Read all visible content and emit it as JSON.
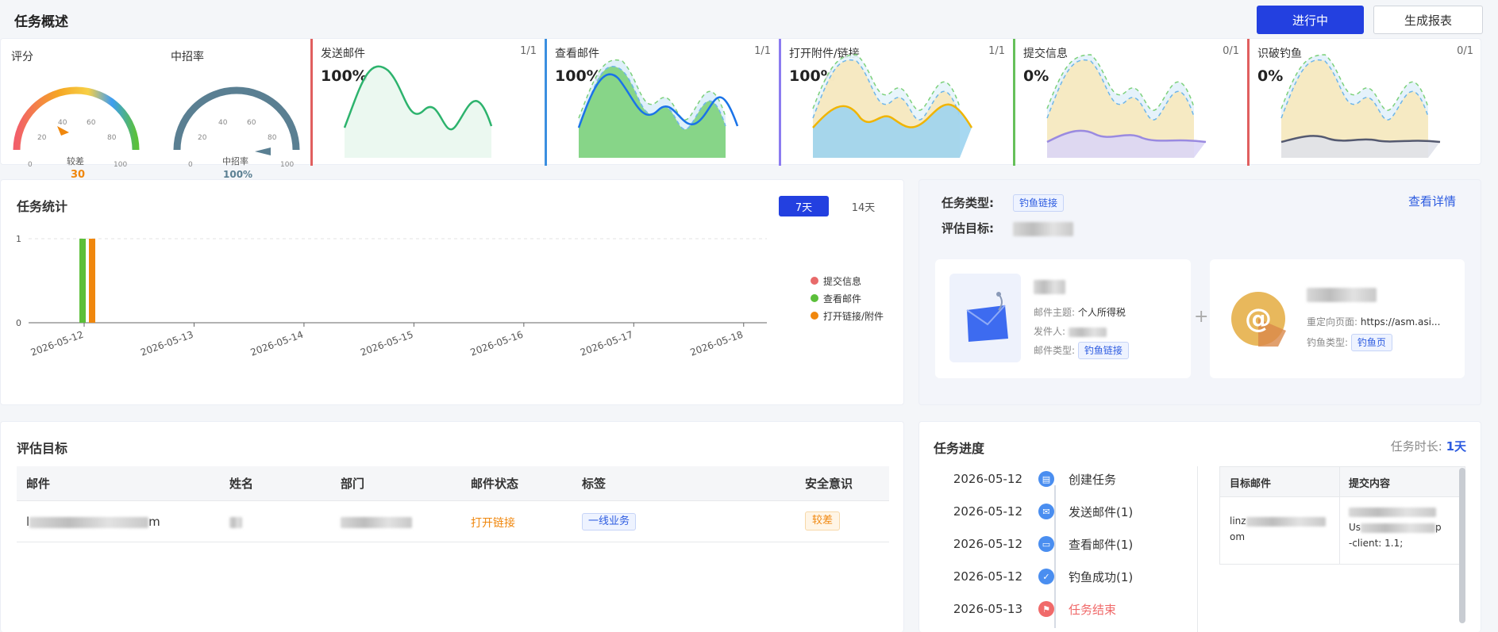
{
  "header": {
    "title": "任务概述",
    "status_button": "进行中",
    "report_button": "生成报表"
  },
  "gauges": {
    "score": {
      "label": "评分",
      "inner_label": "较差",
      "value": "30",
      "ticks": [
        "0",
        "20",
        "40",
        "60",
        "80",
        "100"
      ]
    },
    "rate": {
      "label": "中招率",
      "inner_label": "中招率",
      "value": "100%",
      "ticks": [
        "0",
        "20",
        "40",
        "60",
        "80",
        "100"
      ]
    }
  },
  "metrics": [
    {
      "title": "发送邮件",
      "fraction": "1/1",
      "value": "100%",
      "color": "#e05f5f",
      "line": "#2db36d"
    },
    {
      "title": "查看邮件",
      "fraction": "1/1",
      "value": "100%",
      "color": "#3b8fe0",
      "line": "#1a73e8"
    },
    {
      "title": "打开附件/链接",
      "fraction": "1/1",
      "value": "100%",
      "color": "#8c7bf0",
      "line": "#f0b400"
    },
    {
      "title": "提交信息",
      "fraction": "0/1",
      "value": "0%",
      "color": "#66c05a",
      "line": "#9a8ae0"
    },
    {
      "title": "识破钓鱼",
      "fraction": "0/1",
      "value": "0%",
      "color": "#e05f5f",
      "line": "#555a70"
    }
  ],
  "stats": {
    "title": "任务统计",
    "range_7": "7天",
    "range_14": "14天",
    "legend": [
      {
        "name": "提交信息",
        "color": "#e86a6a"
      },
      {
        "name": "查看邮件",
        "color": "#5bbf3a"
      },
      {
        "name": "打开链接/附件",
        "color": "#f0870d"
      }
    ]
  },
  "chart_data": {
    "type": "bar",
    "categories": [
      "2026-05-12",
      "2026-05-13",
      "2026-05-14",
      "2026-05-15",
      "2026-05-16",
      "2026-05-17",
      "2026-05-18"
    ],
    "series": [
      {
        "name": "提交信息",
        "values": [
          0,
          0,
          0,
          0,
          0,
          0,
          0
        ],
        "color": "#e86a6a"
      },
      {
        "name": "查看邮件",
        "values": [
          1,
          0,
          0,
          0,
          0,
          0,
          0
        ],
        "color": "#5bbf3a"
      },
      {
        "name": "打开链接/附件",
        "values": [
          1,
          0,
          0,
          0,
          0,
          0,
          0
        ],
        "color": "#f0870d"
      }
    ],
    "ylim": [
      0,
      1
    ],
    "yticks": [
      "0",
      "1"
    ],
    "grid": true,
    "legend": "right"
  },
  "taskinfo": {
    "type_label": "任务类型:",
    "type_value": "钓鱼链接",
    "target_label": "评估目标:",
    "detail_link": "查看详情",
    "mail_subject_label": "邮件主题:",
    "mail_subject": "个人所得税",
    "sender_label": "发件人:",
    "mail_type_label": "邮件类型:",
    "mail_type": "钓鱼链接",
    "plus": "+",
    "redirect_label": "重定向页面:",
    "redirect_value": "https://asm.asi...",
    "phish_type_label": "钓鱼类型:",
    "phish_type": "钓鱼页"
  },
  "targets": {
    "title": "评估目标",
    "columns": [
      "邮件",
      "姓名",
      "部门",
      "邮件状态",
      "标签",
      "安全意识"
    ],
    "row": {
      "email_end": "m",
      "email_start": "l",
      "status": "打开链接",
      "tag": "一线业务",
      "awareness": "较差"
    }
  },
  "progress": {
    "title": "任务进度",
    "duration_label": "任务时长:",
    "duration_value": "1天",
    "steps": [
      {
        "date": "2026-05-12",
        "label": "创建任务"
      },
      {
        "date": "2026-05-12",
        "label": "发送邮件(1)"
      },
      {
        "date": "2026-05-12",
        "label": "查看邮件(1)"
      },
      {
        "date": "2026-05-12",
        "label": "钓鱼成功(1)"
      },
      {
        "date": "2026-05-13",
        "label": "任务结束"
      }
    ],
    "table_cols": [
      "目标邮件",
      "提交内容"
    ],
    "cell_email_a": "linz",
    "cell_email_b": "om",
    "cell_content_a": "Us",
    "cell_content_b": "p",
    "cell_content_c": "-client: 1.1;"
  }
}
